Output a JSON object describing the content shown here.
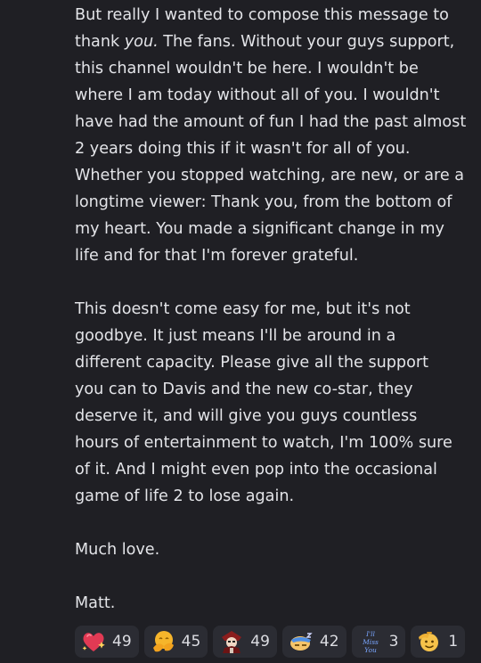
{
  "message": {
    "lines": [
      "But really I wanted to compose this message to",
      "The fans. Without your guys support,",
      "this channel wouldn't be here. I wouldn't be",
      "where I am today without all of you. I wouldn't",
      "have had the amount of fun I had the past almost",
      "2 years doing this if it wasn't for all of you.",
      "Whether you stopped watching, are new, or are a",
      "longtime viewer: Thank you, from the bottom of",
      "my heart. You made a significant change in my",
      "life and for that I'm forever grateful.",
      "This doesn't come easy for me, but it's not",
      "goodbye. It just means I'll be around in a",
      "different capacity. Please give all the support",
      "you can to Davis and the new co-star, they",
      "deserve it, and will give you guys countless",
      "hours of entertainment to watch, I'm 100% sure",
      "of it. And I might even pop into the occasional",
      "game of life 2 to lose again.",
      "Much love.",
      "Matt."
    ],
    "line2_prefix": "thank ",
    "line2_emphasis": "you."
  },
  "reactions": [
    {
      "icon": "sparkle-heart-icon",
      "count": "49"
    },
    {
      "icon": "hug-emoji-icon",
      "count": "45"
    },
    {
      "icon": "custom-character-emoji-icon",
      "count": "49"
    },
    {
      "icon": "custom-sleeping-emoji-icon",
      "count": "42"
    },
    {
      "icon": "ill-miss-you-emoji-icon",
      "count": "3",
      "icon_text": [
        "I'll",
        "Miss",
        "You"
      ]
    },
    {
      "icon": "saluting-face-icon",
      "count": "1"
    }
  ],
  "colors": {
    "background": "#1f1f24",
    "text": "#e3e4e8",
    "reaction_bg": "#2b2c33"
  }
}
